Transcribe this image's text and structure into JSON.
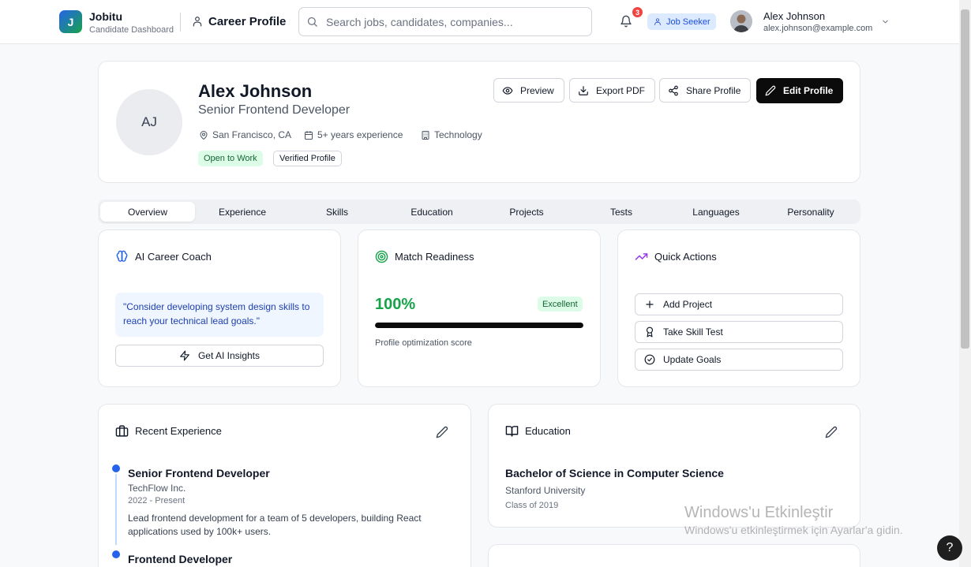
{
  "header": {
    "logo_letter": "J",
    "brand": "Jobitu",
    "brand_sub": "Candidate Dashboard",
    "section_title": "Career Profile",
    "search_placeholder": "Search jobs, candidates, companies...",
    "notification_count": "3",
    "role_badge": "Job Seeker",
    "user_name": "Alex Johnson",
    "user_email": "alex.johnson@example.com"
  },
  "profile": {
    "initials": "AJ",
    "name": "Alex Johnson",
    "title": "Senior Frontend Developer",
    "location": "San Francisco, CA",
    "experience": "5+ years experience",
    "industry": "Technology",
    "tags": [
      "Open to Work",
      "Verified Profile"
    ],
    "actions": {
      "preview": "Preview",
      "export": "Export PDF",
      "share": "Share Profile",
      "edit": "Edit Profile"
    }
  },
  "tabs": [
    {
      "label": "Overview",
      "active": true
    },
    {
      "label": "Experience",
      "active": false
    },
    {
      "label": "Skills",
      "active": false
    },
    {
      "label": "Education",
      "active": false
    },
    {
      "label": "Projects",
      "active": false
    },
    {
      "label": "Tests",
      "active": false
    },
    {
      "label": "Languages",
      "active": false
    },
    {
      "label": "Personality",
      "active": false
    }
  ],
  "coach": {
    "title": "AI Career Coach",
    "quote": "\"Consider developing system design skills to reach your technical lead goals.\"",
    "button": "Get AI Insights"
  },
  "match": {
    "title": "Match Readiness",
    "percent_label": "100%",
    "progress_fraction": 1.0,
    "rating": "Excellent",
    "caption": "Profile optimization score"
  },
  "quick_actions": {
    "title": "Quick Actions",
    "items": [
      "Add Project",
      "Take Skill Test",
      "Update Goals"
    ]
  },
  "experience": {
    "title": "Recent Experience",
    "jobs": [
      {
        "title": "Senior Frontend Developer",
        "company": "TechFlow Inc.",
        "period": "2022 - Present",
        "description": "Lead frontend development for a team of 5 developers, building React applications used by 100k+ users."
      },
      {
        "title": "Frontend Developer"
      }
    ]
  },
  "education": {
    "title": "Education",
    "degree": "Bachelor of Science in Computer Science",
    "school": "Stanford University",
    "class_of": "Class of 2019"
  },
  "watermark": {
    "title": "Windows'u Etkinleştir",
    "subtitle": "Windows'u etkinleştirmek için Ayarlar'a gidin."
  },
  "help_label": "?",
  "colors": {
    "accent_blue": "#2563eb",
    "success_green": "#16a34a",
    "dark_button": "#0b0b0c",
    "coach_quote_bg": "#eff6ff"
  }
}
